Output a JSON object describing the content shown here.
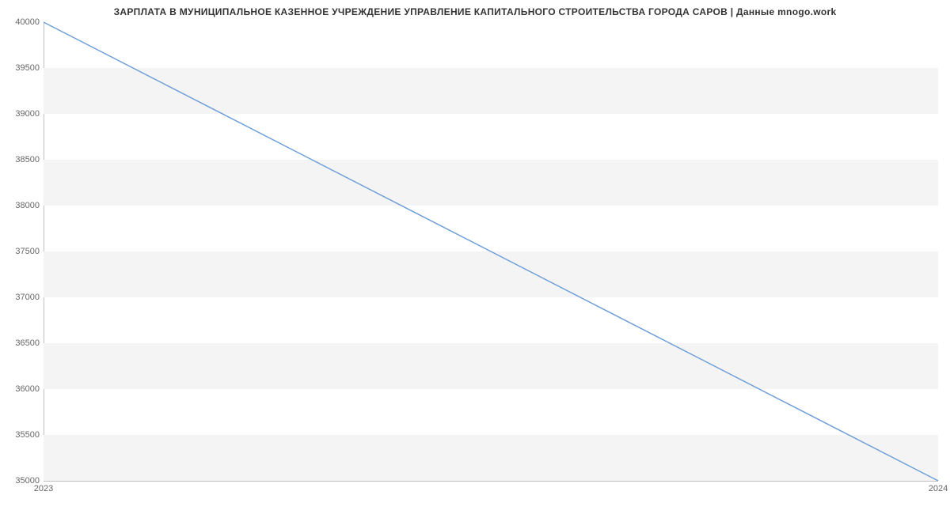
{
  "chart_data": {
    "type": "line",
    "title": "ЗАРПЛАТА В МУНИЦИПАЛЬНОЕ КАЗЕННОЕ УЧРЕЖДЕНИЕ УПРАВЛЕНИЕ КАПИТАЛЬНОГО СТРОИТЕЛЬСТВА  ГОРОДА САРОВ | Данные mnogo.work",
    "x": [
      2023,
      2024
    ],
    "values": [
      40000,
      35000
    ],
    "xlabel": "",
    "ylabel": "",
    "ylim": [
      35000,
      40000
    ],
    "xlim": [
      2023,
      2024
    ],
    "y_ticks": [
      35000,
      35500,
      36000,
      36500,
      37000,
      37500,
      38000,
      38500,
      39000,
      39500,
      40000
    ],
    "x_ticks": [
      2023,
      2024
    ],
    "grid": true,
    "line_color": "#6f9fd8"
  }
}
